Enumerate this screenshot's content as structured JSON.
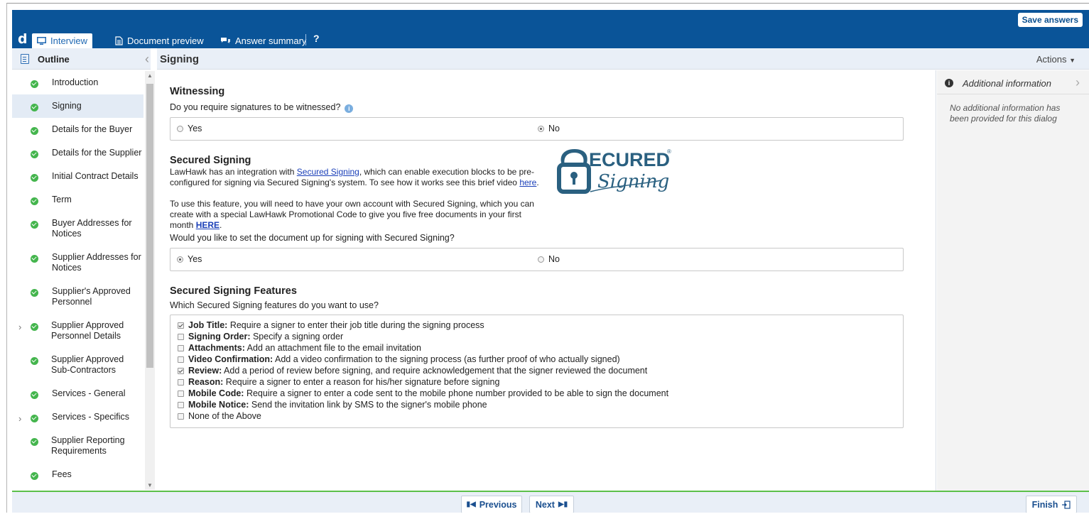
{
  "topbar": {
    "save_label": "Save answers"
  },
  "tabs": {
    "logo": "d",
    "interview": "Interview",
    "document_preview": "Document preview",
    "answer_summary": "Answer summary",
    "help": "?"
  },
  "outline": {
    "title": "Outline",
    "items": [
      {
        "label": "Introduction"
      },
      {
        "label": "Signing"
      },
      {
        "label": "Details for the Buyer"
      },
      {
        "label": "Details for the Supplier"
      },
      {
        "label": "Initial Contract Details"
      },
      {
        "label": "Term"
      },
      {
        "label": "Buyer Addresses for Notices"
      },
      {
        "label": "Supplier Addresses for Notices"
      },
      {
        "label": "Supplier's Approved Personnel"
      },
      {
        "label": "Supplier Approved Personnel Details"
      },
      {
        "label": "Supplier Approved Sub-Contractors"
      },
      {
        "label": "Services - General"
      },
      {
        "label": "Services - Specifics"
      },
      {
        "label": "Supplier Reporting Requirements"
      },
      {
        "label": "Fees"
      }
    ]
  },
  "main": {
    "title": "Signing",
    "actions": "Actions",
    "witnessing": {
      "title": "Witnessing",
      "question": "Do you require signatures to be witnessed?",
      "options": [
        "Yes",
        "No"
      ],
      "selected": "No"
    },
    "secured": {
      "title": "Secured Signing",
      "p1_a": "LawHawk has an integration with ",
      "p1_link": "Secured Signing",
      "p1_b": ", which can enable execution blocks to be pre-configured for signing via Secured Signing's system. To see how it works see this brief video ",
      "p1_link2": "here",
      "p1_c": ".",
      "p2_a": "To use this feature, you will need to have your own account with Secured Signing, which you can create with a special LawHawk Promotional Code to give you five free documents in your first month ",
      "p2_link": "HERE",
      "p2_b": ".",
      "question": "Would you like to set the document up for signing with Secured Signing?",
      "options": [
        "Yes",
        "No"
      ],
      "selected": "Yes",
      "logo_text_top": "ECURED",
      "logo_text_bottom": "Signing",
      "logo_reg": "®"
    },
    "features": {
      "title": "Secured Signing Features",
      "question": "Which Secured Signing features do you want to use?",
      "items": [
        {
          "bold": "Job Title:",
          "text": " Require a signer to enter their job title during the signing process",
          "checked": true
        },
        {
          "bold": "Signing Order:",
          "text": " Specify a signing order",
          "checked": false
        },
        {
          "bold": "Attachments:",
          "text": " Add an attachment file to the email invitation",
          "checked": false
        },
        {
          "bold": "Video Confirmation:",
          "text": " Add a video confirmation to the signing process (as further proof of who actually signed)",
          "checked": false
        },
        {
          "bold": "Review:",
          "text": " Add a period of review before signing, and require acknowledgement that the signer reviewed the document",
          "checked": true
        },
        {
          "bold": "Reason:",
          "text": " Require a signer to enter a reason for his/her signature before signing",
          "checked": false
        },
        {
          "bold": "Mobile Code:",
          "text": " Require a signer to enter a code sent to the mobile phone number provided to be able to sign the document",
          "checked": false
        },
        {
          "bold": "Mobile Notice:",
          "text": " Send the invitation link by SMS to the signer's mobile phone",
          "checked": false
        },
        {
          "bold": "",
          "text": "None of the Above",
          "checked": false
        }
      ]
    }
  },
  "side": {
    "title": "Additional information",
    "body": "No additional information has been provided for this dialog"
  },
  "footer": {
    "previous": "Previous",
    "next": "Next",
    "finish": "Finish"
  },
  "colors": {
    "brand_blue": "#0a5498",
    "check_green": "#44b54d",
    "link_blue": "#1a3fb8",
    "footer_line": "#5cc04a",
    "logo_teal": "#2a6080"
  }
}
